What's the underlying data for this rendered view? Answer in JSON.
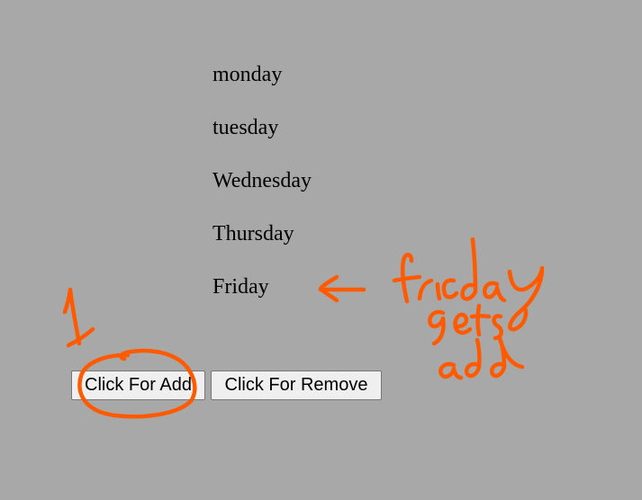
{
  "days": [
    {
      "label": "monday"
    },
    {
      "label": "tuesday"
    },
    {
      "label": "Wednesday"
    },
    {
      "label": "Thursday"
    },
    {
      "label": "Friday"
    }
  ],
  "buttons": {
    "add_label": "Click For Add",
    "remove_label": "Click For Remove"
  },
  "annotations": {
    "step_number": "1",
    "note_text": "friday gets add",
    "ink_color": "#ff5a00"
  },
  "background_color": "#a8a8a8"
}
